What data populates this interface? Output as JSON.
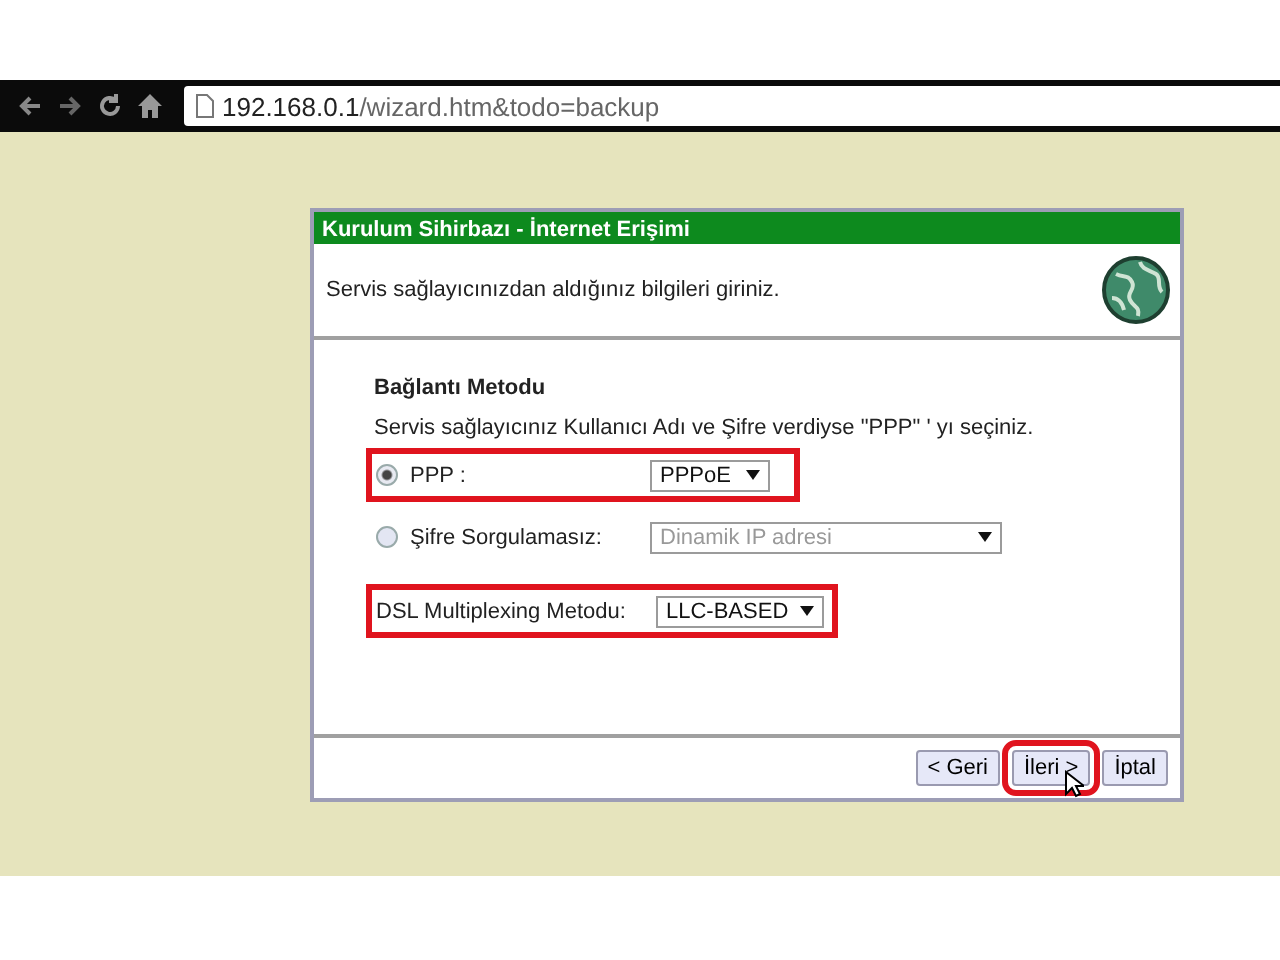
{
  "browser": {
    "url_host": "192.168.0.1",
    "url_path": "/wizard.htm&todo=backup"
  },
  "wizard": {
    "title": "Kurulum Sihirbazı - İnternet Erişimi",
    "intro": "Servis sağlayıcınızdan aldığınız bilgileri giriniz.",
    "section_title": "Bağlantı Metodu",
    "hint": "Servis sağlayıcınız Kullanıcı Adı ve Şifre verdiyse \"PPP\" ' yı seçiniz.",
    "options": [
      {
        "label": "PPP :",
        "selected": true,
        "value": "PPPoE",
        "disabled": false,
        "highlighted": true
      },
      {
        "label": "Şifre Sorgulamasız:",
        "selected": false,
        "value": "Dinamik IP adresi",
        "disabled": true,
        "highlighted": false
      }
    ],
    "multiplexing": {
      "label": "DSL Multiplexing Metodu:",
      "value": "LLC-BASED",
      "highlighted": true
    },
    "buttons": [
      {
        "label": "< Geri",
        "highlighted": false
      },
      {
        "label": "İleri >",
        "highlighted": true
      },
      {
        "label": "İptal",
        "highlighted": false
      }
    ]
  }
}
